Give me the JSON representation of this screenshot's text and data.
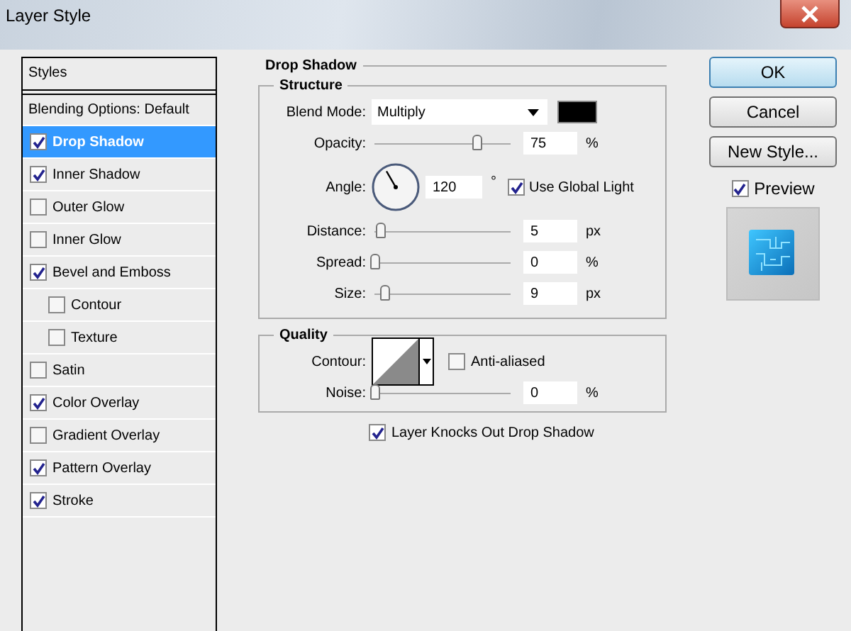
{
  "window": {
    "title": "Layer Style"
  },
  "styles_panel": {
    "header": "Styles",
    "blending_options": {
      "label": "Blending Options: Default",
      "selected": false
    },
    "effects": [
      {
        "label": "Drop Shadow",
        "checked": true,
        "selected": true
      },
      {
        "label": "Inner Shadow",
        "checked": true,
        "selected": false
      },
      {
        "label": "Outer Glow",
        "checked": false,
        "selected": false
      },
      {
        "label": "Inner Glow",
        "checked": false,
        "selected": false
      },
      {
        "label": "Bevel and Emboss",
        "checked": true,
        "selected": false,
        "children": [
          {
            "label": "Contour",
            "checked": false,
            "selected": false
          },
          {
            "label": "Texture",
            "checked": false,
            "selected": false
          }
        ]
      },
      {
        "label": "Satin",
        "checked": false,
        "selected": false
      },
      {
        "label": "Color Overlay",
        "checked": true,
        "selected": false
      },
      {
        "label": "Gradient Overlay",
        "checked": false,
        "selected": false
      },
      {
        "label": "Pattern Overlay",
        "checked": true,
        "selected": false
      },
      {
        "label": "Stroke",
        "checked": true,
        "selected": false
      }
    ]
  },
  "drop_shadow": {
    "title": "Drop Shadow",
    "structure": {
      "title": "Structure",
      "blend_mode": {
        "label": "Blend Mode:",
        "value": "Multiply",
        "color": "#000000"
      },
      "opacity": {
        "label": "Opacity:",
        "level": 0.75,
        "value": "75",
        "unit": "%"
      },
      "angle": {
        "label": "Angle:",
        "value": "120",
        "unit": "°",
        "use_global_light": {
          "label": "Use Global Light",
          "checked": true
        }
      },
      "distance": {
        "label": "Distance:",
        "level": 0.04,
        "value": "5",
        "unit": "px"
      },
      "spread": {
        "label": "Spread:",
        "level": 0,
        "value": "0",
        "unit": "%"
      },
      "size": {
        "label": "Size:",
        "level": 0.07,
        "value": "9",
        "unit": "px"
      }
    },
    "quality": {
      "title": "Quality",
      "contour": {
        "label": "Contour:",
        "anti_aliased": {
          "label": "Anti-aliased",
          "checked": false
        }
      },
      "noise": {
        "label": "Noise:",
        "level": 0,
        "value": "0",
        "unit": "%"
      }
    },
    "layer_knocks_out": {
      "label": "Layer Knocks Out Drop Shadow",
      "checked": true
    }
  },
  "buttons": [
    {
      "label": "OK",
      "default": true
    },
    {
      "label": "Cancel",
      "default": false
    },
    {
      "label": "New Style...",
      "default": false
    }
  ],
  "preview": {
    "label": "Preview",
    "checked": true
  }
}
